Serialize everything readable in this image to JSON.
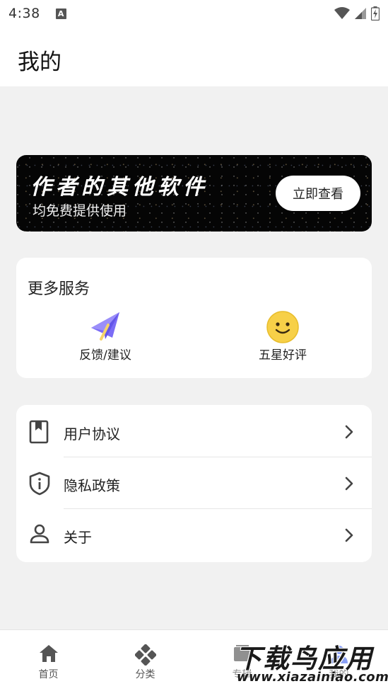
{
  "status_bar": {
    "time": "4:38",
    "notification_badge": "A",
    "icons": [
      "wifi-icon",
      "signal-icon",
      "battery-icon"
    ]
  },
  "header": {
    "title": "我的"
  },
  "banner": {
    "title": "作者的其他软件",
    "subtitle": "均免费提供使用",
    "button_label": "立即查看"
  },
  "services": {
    "title": "更多服务",
    "items": [
      {
        "label": "反馈/建议",
        "icon": "paper-plane-icon",
        "color": "#7b6cf6"
      },
      {
        "label": "五星好评",
        "icon": "smiley-face-icon",
        "color": "#f7d048"
      }
    ]
  },
  "menu": {
    "items": [
      {
        "label": "用户协议",
        "icon": "bookmark-book-icon"
      },
      {
        "label": "隐私政策",
        "icon": "shield-info-icon"
      },
      {
        "label": "关于",
        "icon": "person-icon"
      }
    ]
  },
  "bottom_nav": {
    "items": [
      {
        "label": "首页",
        "icon": "home-icon"
      },
      {
        "label": "分类",
        "icon": "gamepad-icon"
      },
      {
        "label": "专辑",
        "icon": "album-icon"
      },
      {
        "label": "我的",
        "icon": "user-icon",
        "active": true
      }
    ]
  },
  "watermark": {
    "main": "下载鸟应用",
    "sub": "www.xiazainiao.com"
  },
  "colors": {
    "accent_purple": "#7b6cf6",
    "smiley_yellow": "#f7d048",
    "background": "#f1f1f1",
    "banner_bg": "#050505"
  }
}
